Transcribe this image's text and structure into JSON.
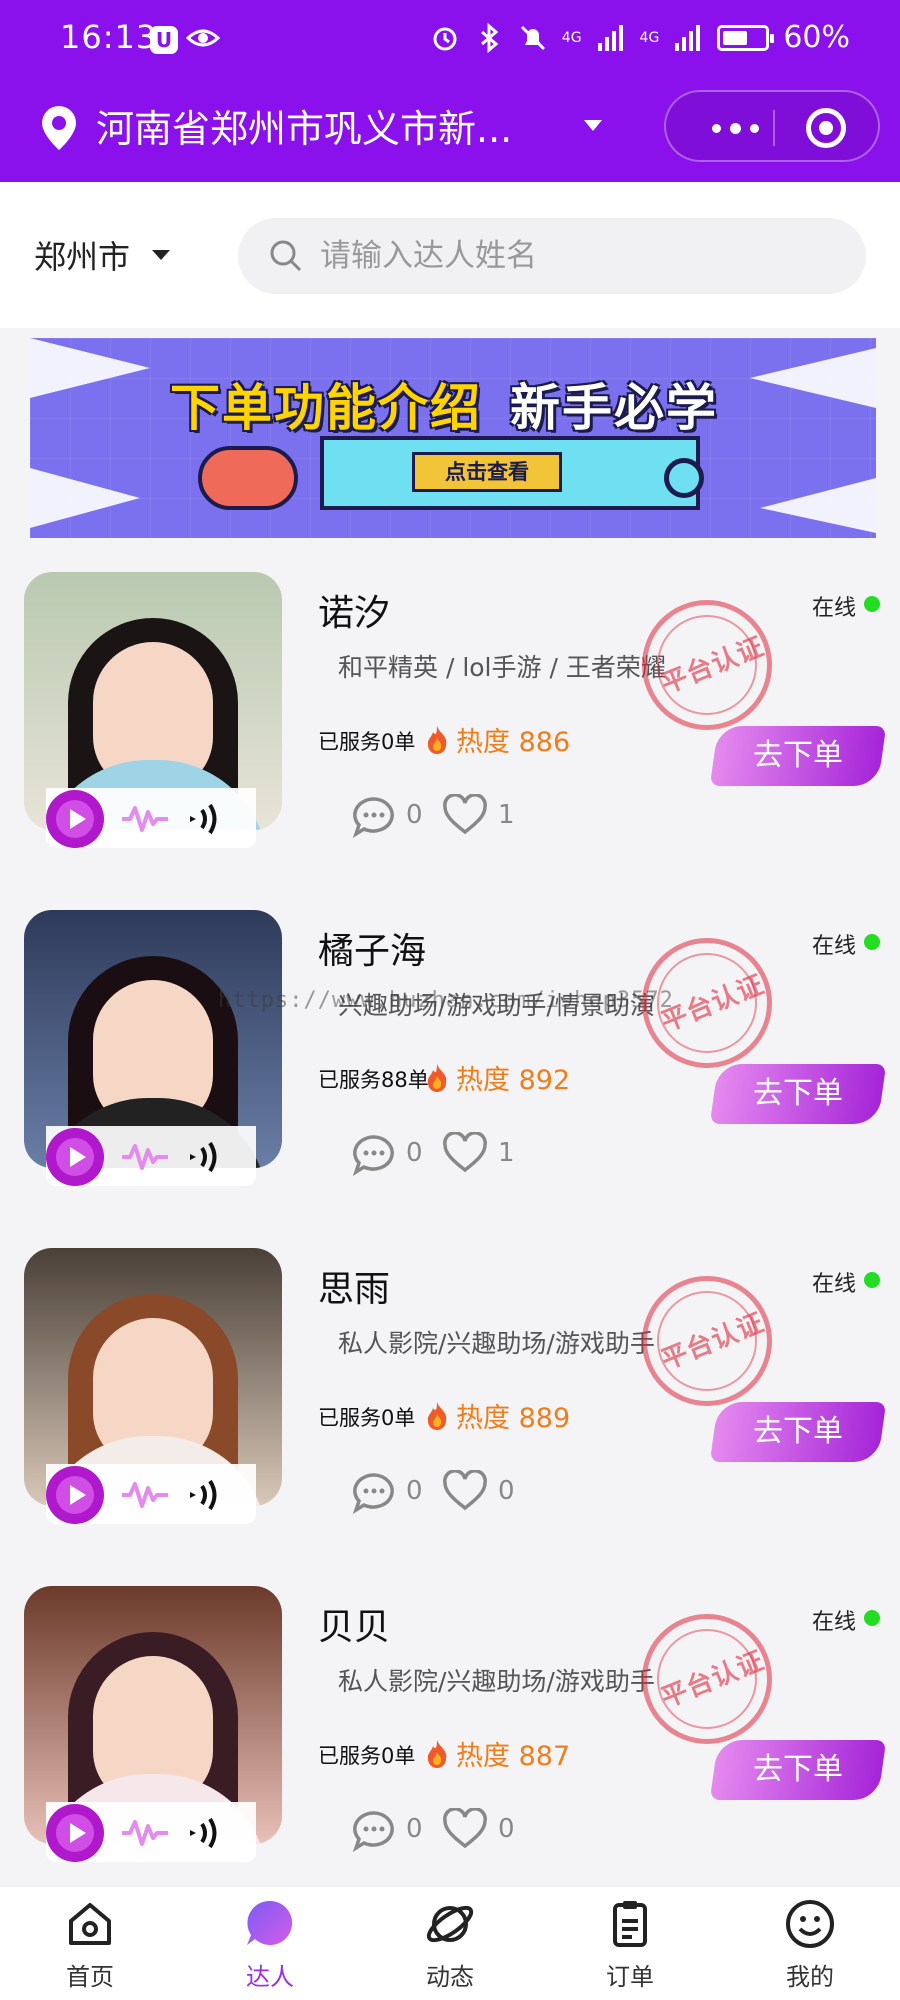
{
  "status_bar": {
    "time": "16:13",
    "network_1": "4G",
    "network_2": "4G",
    "battery_percent": "60%",
    "battery_level": 0.6
  },
  "header": {
    "location": "河南省郑州市巩义市新...",
    "accent_color": "#8a10ec"
  },
  "search": {
    "city": "郑州市",
    "placeholder": "请输入达人姓名",
    "value": ""
  },
  "banner": {
    "title_part1": "下单功能介绍",
    "title_part2": "新手必学",
    "button_label": "点击查看"
  },
  "talents": [
    {
      "name": "诺汐",
      "status": "在线",
      "tags": "和平精英 / lol手游 / 王者荣耀",
      "stamp": "平台认证",
      "served": "已服务0单",
      "heat_label": "热度",
      "heat": "886",
      "order_label": "去下单",
      "comments": "0",
      "likes": "1"
    },
    {
      "name": "橘子海",
      "status": "在线",
      "tags": "兴趣助场/游戏助手/情景助演",
      "stamp": "平台认证",
      "served": "已服务88单",
      "heat_label": "热度",
      "heat": "892",
      "order_label": "去下单",
      "comments": "0",
      "likes": "1"
    },
    {
      "name": "思雨",
      "status": "在线",
      "tags": "私人影院/兴趣助场/游戏助手",
      "stamp": "平台认证",
      "served": "已服务0单",
      "heat_label": "热度",
      "heat": "889",
      "order_label": "去下单",
      "comments": "0",
      "likes": "0"
    },
    {
      "name": "贝贝",
      "status": "在线",
      "tags": "私人影院/兴趣助场/游戏助手",
      "stamp": "平台认证",
      "served": "已服务0单",
      "heat_label": "热度",
      "heat": "887",
      "order_label": "去下单",
      "comments": "0",
      "likes": "0"
    }
  ],
  "watermark": "https://www.huzhan.com/ishop3572",
  "tabbar": [
    {
      "label": "首页",
      "icon": "home-icon",
      "active": false
    },
    {
      "label": "达人",
      "icon": "chat-bubble-icon",
      "active": true
    },
    {
      "label": "动态",
      "icon": "planet-icon",
      "active": false
    },
    {
      "label": "订单",
      "icon": "clipboard-icon",
      "active": false
    },
    {
      "label": "我的",
      "icon": "smiley-icon",
      "active": false
    }
  ]
}
